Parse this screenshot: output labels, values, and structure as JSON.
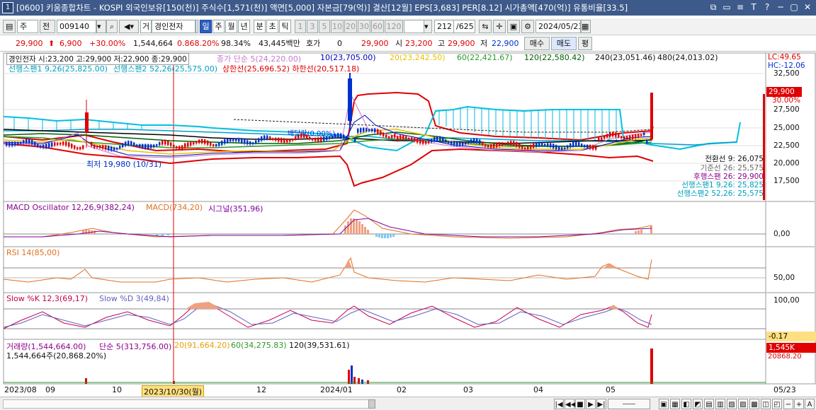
{
  "window": {
    "badge": "1",
    "title": "[0600] 키움종합차트 - KOSPI 외국인보유[150(천)] 주식수[1,571(천)] 액면[5,000] 자본금[79(억)] 결산[12월] EPS[3,683] PER[8.12] 시가총액[470(억)] 유통비율[33.5]",
    "controls": [
      "⧉",
      "▭",
      "≡",
      "T",
      "?",
      "─",
      "▢",
      "✕"
    ]
  },
  "toolbar": {
    "market": "주",
    "prefix": "전",
    "code": "009140",
    "name": "경인전자",
    "name_prefix": "거",
    "periods": [
      "일",
      "주",
      "월",
      "년",
      "분",
      "초",
      "틱"
    ],
    "active_period": "일",
    "intervals": [
      "1",
      "3",
      "5",
      "10",
      "20",
      "30",
      "60",
      "120"
    ],
    "count": "212",
    "total": "/625",
    "date": "2024/05/23"
  },
  "quote": {
    "price": "29,900",
    "change": "6,900",
    "change_pct": "+30.00%",
    "volume": "1,544,664",
    "vol_ratio": "0.868.20%",
    "turnover": "98.34%",
    "amount": "43,445백만",
    "hoga_label": "호가",
    "hoga_value": "0",
    "hoga_price": "29,900",
    "open_label": "시",
    "open": "23,200",
    "high_label": "고",
    "high": "29,900",
    "low_label": "저",
    "low": "22,900",
    "buy_label": "매수",
    "sell_label": "매도",
    "avg_label": "평"
  },
  "price_panel": {
    "header": "경인전자 시:23,200 고:29,900 저:22,900 종:29,900",
    "ma": [
      {
        "label": "종가 단순 5(24,220.00)",
        "color": "#c878c8"
      },
      {
        "label": "10(23,705.00)",
        "color": "#0000c0"
      },
      {
        "label": "20(23,242.50)",
        "color": "#e6c000"
      },
      {
        "label": "60(22,421.67)",
        "color": "#2a9a2a"
      },
      {
        "label": "120(22,580.42)",
        "color": "#006000"
      },
      {
        "label": "240(23,051.46)",
        "color": "#000000"
      },
      {
        "label": "480(24,013.02)",
        "color": "#000000"
      }
    ],
    "ichimoku_line": "선행스팬1 9,26(25,825.00)",
    "ichimoku_line2": "선행스팬2 52,26(25,575.00)",
    "envelope": "상한선(25,696.52) 하한선(20,517.18)",
    "extra_label": "외국인 보유",
    "dividend": "배당락(0.00%)",
    "low_mark": "최저 19,980 (10/31)",
    "right_values": [
      "전환선 9: 26,075",
      "기준선 26: 25,575",
      "후행스팬 26: 29,900",
      "선행스팬1 9,26: 25,825",
      "선행스팬2 52,26: 25,575"
    ],
    "right_colors": [
      "#000000",
      "#666666",
      "#8b008b",
      "#00a0c0",
      "#00a0c0"
    ],
    "lc": "LC:49.65",
    "hc": "HC:-12.06",
    "yticks": [
      "32,500",
      "30,000",
      "27,500",
      "25,000",
      "22,500",
      "20,000",
      "17,500"
    ],
    "price_tag": "29,900",
    "pct_tag": "30.00%",
    "color_up": "#e00000",
    "color_down": "#0030d0"
  },
  "macd_panel": {
    "label1": "MACD Oscillator 12,26,9(382,24)",
    "label2": "MACD(734,20)",
    "label3": "시그널(351,96)",
    "ytick": "0,00"
  },
  "rsi_panel": {
    "label": "RSI 14(85,00)",
    "ytick": "50,00"
  },
  "stoch_panel": {
    "label1": "Slow %K 12,3(69,17)",
    "label2": "Slow %D 3(49,84)",
    "ytick": "100,00",
    "tag": "-0.17"
  },
  "volume_panel": {
    "label1": "거래량(1,544,664.00)",
    "label2": "단순 5(313,756.00)",
    "label3": "20(91,664.20)",
    "label4": "60(34,275.83)",
    "label5": "120(39,531.61)",
    "sub": "1,544,664주(20,868.20%)",
    "tag": "1,545K",
    "tag2": "20868.20"
  },
  "xaxis": [
    "2023/08",
    "09",
    "10",
    "2023/10/30(월)",
    "12",
    "2024/01",
    "02",
    "03",
    "04",
    "05",
    "05/23"
  ]
}
